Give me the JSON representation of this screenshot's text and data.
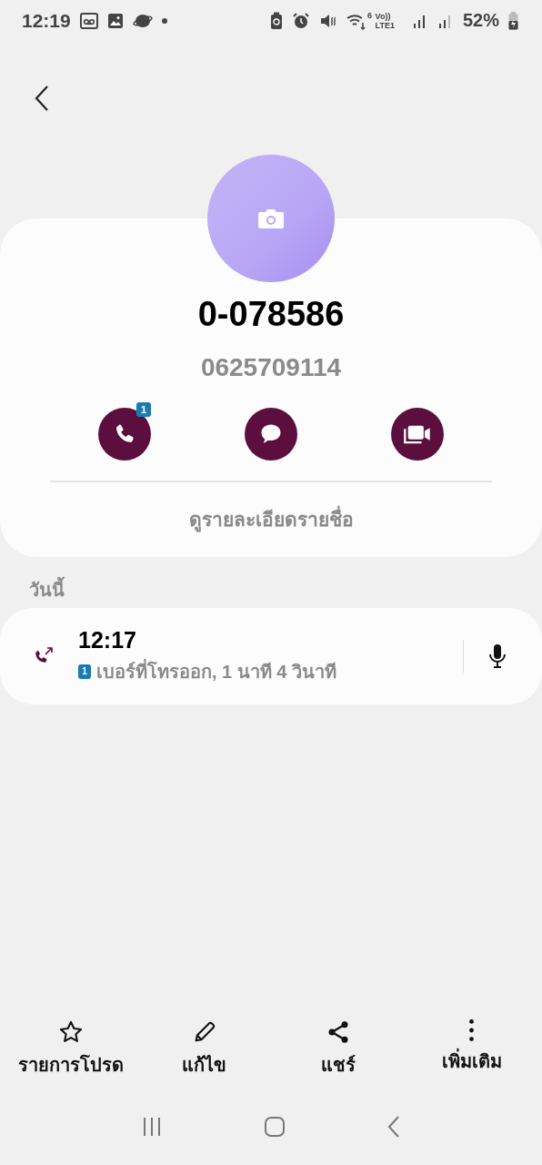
{
  "status_bar": {
    "time": "12:19",
    "network_top": "Vo))",
    "network_bottom": "LTE1",
    "wifi_badge": "6",
    "battery": "52%"
  },
  "contact": {
    "name": "0-078586",
    "number": "0625709114"
  },
  "actions": [
    {
      "kind": "call",
      "badge": "1"
    },
    {
      "kind": "message"
    },
    {
      "kind": "video"
    }
  ],
  "details_link": "ดูรายละเอียดรายชื่อ",
  "section_title": "วันนี้",
  "calls": [
    {
      "time": "12:17",
      "sim": "1",
      "description": "เบอร์ที่โทรออก, 1 นาที 4 วินาที",
      "recorded": true
    }
  ],
  "bottom_bar": [
    {
      "kind": "favorite",
      "label": "รายการโปรด"
    },
    {
      "kind": "edit",
      "label": "แก้ไข"
    },
    {
      "kind": "share",
      "label": "แชร์"
    },
    {
      "kind": "more",
      "label": "เพิ่มเติม"
    }
  ]
}
